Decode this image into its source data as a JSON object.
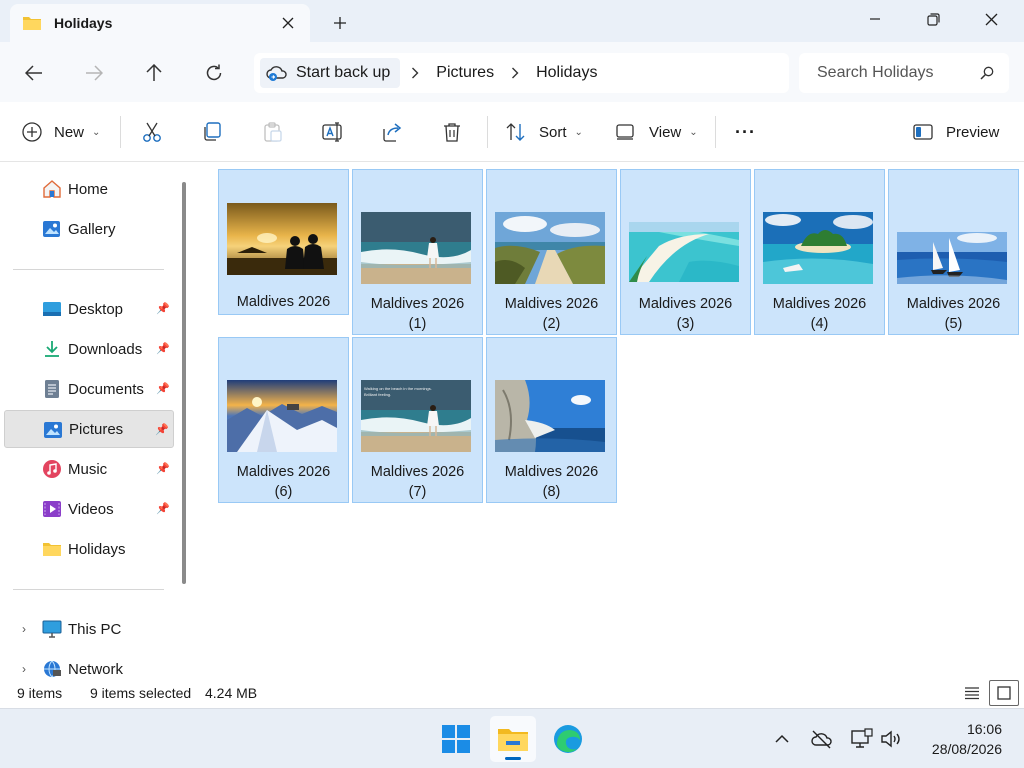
{
  "window": {
    "tab_title": "Holidays",
    "new_tab_symbol": "+"
  },
  "address": {
    "crumbs": [
      "Start back up",
      "Pictures",
      "Holidays"
    ]
  },
  "search": {
    "placeholder": "Search Holidays"
  },
  "toolbar": {
    "new_label": "New",
    "sort_label": "Sort",
    "view_label": "View",
    "more_label": "···",
    "preview_label": "Preview"
  },
  "sidebar": {
    "items": [
      {
        "label": "Home",
        "icon": "home-icon"
      },
      {
        "label": "Gallery",
        "icon": "gallery-icon"
      },
      {
        "label": "Desktop",
        "icon": "desktop-icon",
        "pinned": true
      },
      {
        "label": "Downloads",
        "icon": "downloads-icon",
        "pinned": true
      },
      {
        "label": "Documents",
        "icon": "documents-icon",
        "pinned": true
      },
      {
        "label": "Pictures",
        "icon": "pictures-icon",
        "pinned": true,
        "selected": true
      },
      {
        "label": "Music",
        "icon": "music-icon",
        "pinned": true
      },
      {
        "label": "Videos",
        "icon": "videos-icon",
        "pinned": true
      },
      {
        "label": "Holidays",
        "icon": "folder-icon"
      },
      {
        "label": "This PC",
        "icon": "this-pc-icon"
      },
      {
        "label": "Network",
        "icon": "network-icon"
      }
    ]
  },
  "files": [
    {
      "name": "Maldives 2026",
      "num": "",
      "scene": "sunset-couple"
    },
    {
      "name": "Maldives 2026",
      "num": "(1)",
      "scene": "beach-girl"
    },
    {
      "name": "Maldives 2026",
      "num": "(2)",
      "scene": "dune-path"
    },
    {
      "name": "Maldives 2026",
      "num": "(3)",
      "scene": "sandbar"
    },
    {
      "name": "Maldives 2026",
      "num": "(4)",
      "scene": "island"
    },
    {
      "name": "Maldives 2026",
      "num": "(5)",
      "scene": "sailboats"
    },
    {
      "name": "Maldives 2026",
      "num": "(6)",
      "scene": "snow-mountain"
    },
    {
      "name": "Maldives 2026",
      "num": "(7)",
      "scene": "beach-girl-text"
    },
    {
      "name": "Maldives 2026",
      "num": "(8)",
      "scene": "cliff-sea"
    }
  ],
  "thumb_caption": "Walking on the beach in the mornings. Brilliant feeling.",
  "status": {
    "count": "9 items",
    "selected": "9 items selected",
    "size": "4.24 MB"
  },
  "clock": {
    "time": "16:06",
    "date": "28/08/2026"
  },
  "colors": {
    "accent": "#0067c0",
    "selection_fill": "#cce4fb",
    "selection_border": "#99c9f5"
  }
}
